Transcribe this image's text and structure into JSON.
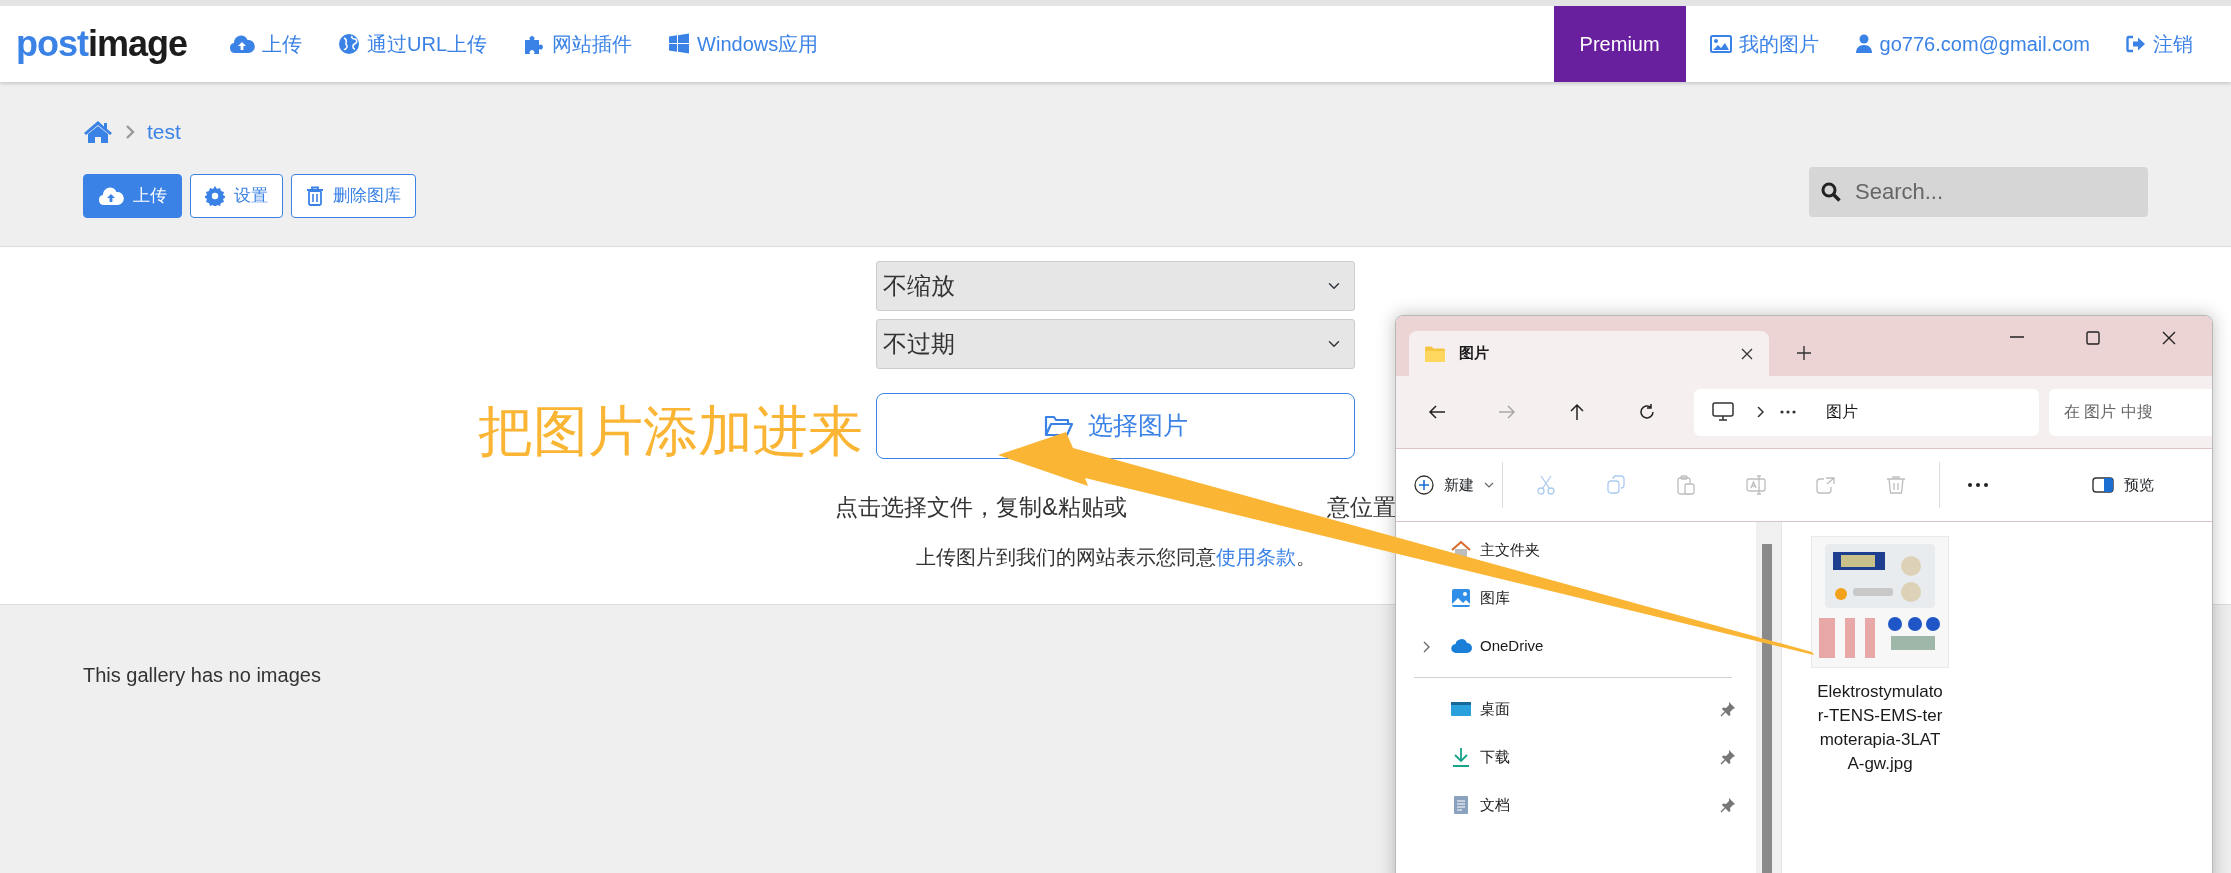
{
  "navbar": {
    "logo_parts": [
      "post",
      "image"
    ],
    "links": [
      {
        "label": "上传"
      },
      {
        "label": "通过URL上传"
      },
      {
        "label": "网站插件"
      },
      {
        "label": "Windows应用"
      }
    ],
    "premium": "Premium",
    "right_links": [
      {
        "label": "我的图片"
      },
      {
        "label": "go776.com@gmail.com"
      },
      {
        "label": "注销"
      }
    ]
  },
  "breadcrumb": {
    "current": "test"
  },
  "toolbar": [
    {
      "label": "上传",
      "kind": "primary"
    },
    {
      "label": "设置",
      "kind": "outline"
    },
    {
      "label": "删除图库",
      "kind": "outline"
    }
  ],
  "search": {
    "placeholder": "Search..."
  },
  "upload": {
    "selects": [
      {
        "value": "不缩放"
      },
      {
        "value": "不过期"
      }
    ],
    "choose_button": "选择图片",
    "hint_parts": [
      "点击选择文件，复制&粘贴或",
      "意位置"
    ],
    "terms": {
      "text": "上传图片到我们的网站表示您同意",
      "link": "使用条款",
      "end": "。"
    }
  },
  "annotation": {
    "text": "把图片添加进来"
  },
  "gallery": {
    "empty_message": "This gallery has no images"
  },
  "explorer": {
    "tab_title": "图片",
    "address": "图片",
    "search_placeholder": "在 图片 中搜",
    "nav_buttons": [
      {
        "disabled": false
      },
      {
        "disabled": true
      },
      {
        "disabled": false
      },
      {
        "disabled": false
      }
    ],
    "new_button": "新建",
    "actions": [
      {
        "disabled": true
      },
      {
        "disabled": true
      },
      {
        "disabled": true
      },
      {
        "disabled": true
      },
      {
        "disabled": true
      },
      {
        "disabled": true
      }
    ],
    "preview_button": "预览",
    "nav_sections": [
      [
        {
          "label": "主文件夹",
          "kind": "plain",
          "pinned": false
        },
        {
          "label": "图库",
          "kind": "plain",
          "pinned": false
        },
        {
          "label": "OneDrive",
          "kind": "expandable",
          "pinned": false
        }
      ],
      [
        {
          "label": "桌面",
          "kind": "plain",
          "pinned": true
        },
        {
          "label": "下载",
          "kind": "plain",
          "pinned": true
        },
        {
          "label": "文档",
          "kind": "plain",
          "pinned": true
        }
      ]
    ],
    "files": [
      {
        "name": "Elektrostymulator-TENS-EMS-termoterapia-3LATA-gw.jpg",
        "kind": "picture"
      }
    ]
  }
}
